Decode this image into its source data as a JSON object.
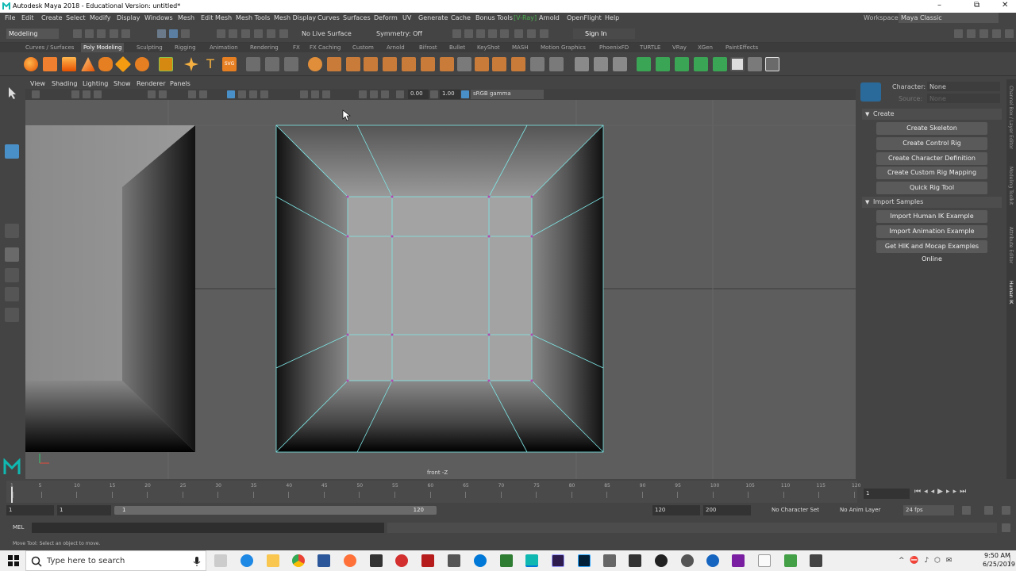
{
  "window": {
    "title": "Autodesk Maya 2018 - Educational Version: untitled*",
    "minimize": "–",
    "restore": "⧉",
    "close": "✕"
  },
  "menus": [
    "File",
    "Edit",
    "Create",
    "Select",
    "Modify",
    "Display",
    "Windows",
    "Mesh",
    "Edit Mesh",
    "Mesh Tools",
    "Mesh Display",
    "Curves",
    "Surfaces",
    "Deform",
    "UV",
    "Generate",
    "Cache",
    "Bonus Tools",
    "[V-Ray]",
    "Arnold",
    "OpenFlight",
    "Help"
  ],
  "workspace": {
    "label": "Workspace :",
    "value": "Maya Classic"
  },
  "statusline": {
    "mode": "Modeling",
    "live_surface": "No Live Surface",
    "symmetry": "Symmetry: Off",
    "sign_in": "Sign In"
  },
  "shelf_tabs": [
    "Curves / Surfaces",
    "Poly Modeling",
    "Sculpting",
    "Rigging",
    "Animation",
    "Rendering",
    "FX",
    "FX Caching",
    "Custom",
    "Arnold",
    "Bifrost",
    "Bullet",
    "KeyShot",
    "MASH",
    "Motion Graphics",
    "PhoenixFD",
    "TURTLE",
    "VRay",
    "XGen",
    "PaintEffects"
  ],
  "shelf_active": "Poly Modeling",
  "panel_menus": [
    "View",
    "Shading",
    "Lighting",
    "Show",
    "Renderer",
    "Panels"
  ],
  "panel_toolbar": {
    "exposure": "0.00",
    "gamma": "1.00",
    "color_space": "sRGB gamma"
  },
  "viewport": {
    "camera_label": "front -Z"
  },
  "hik": {
    "character_label": "Character:",
    "character_value": "None",
    "source_label": "Source:",
    "source_value": "None",
    "create_section": "Create",
    "create_buttons": [
      "Create Skeleton",
      "Create Control Rig",
      "Create Character Definition",
      "Create Custom Rig Mapping",
      "Quick Rig Tool"
    ],
    "import_section": "Import Samples",
    "import_buttons": [
      "Import Human IK Example",
      "Import Animation Example",
      "Get HIK and Mocap Examples Online"
    ]
  },
  "side_tabs": [
    "Channel Box / Layer Editor",
    "Modeling Toolkit",
    "Attribute Editor",
    "Human IK"
  ],
  "timeline": {
    "ticks": [
      "1",
      "5",
      "10",
      "15",
      "20",
      "25",
      "30",
      "35",
      "40",
      "45",
      "50",
      "55",
      "60",
      "65",
      "70",
      "75",
      "80",
      "85",
      "90",
      "95",
      "100",
      "105",
      "110",
      "115",
      "120"
    ],
    "current_frame": "1"
  },
  "range": {
    "start": "1",
    "anim_start": "1",
    "slider_start": "1",
    "slider_end": "120",
    "end": "120",
    "anim_end": "200",
    "char_set": "No Character Set",
    "anim_layer": "No Anim Layer",
    "fps": "24 fps"
  },
  "cmdline": {
    "label": "MEL"
  },
  "help_line": "Move Tool: Select an object to move.",
  "taskbar": {
    "search_placeholder": "Type here to search",
    "time": "9:50 AM",
    "date": "6/25/2019"
  },
  "colors": {
    "accent": "#4fc3f7",
    "wire": "#7fe6e6",
    "maya_logo": "#0fb9b1",
    "vray": "#4caf50"
  }
}
